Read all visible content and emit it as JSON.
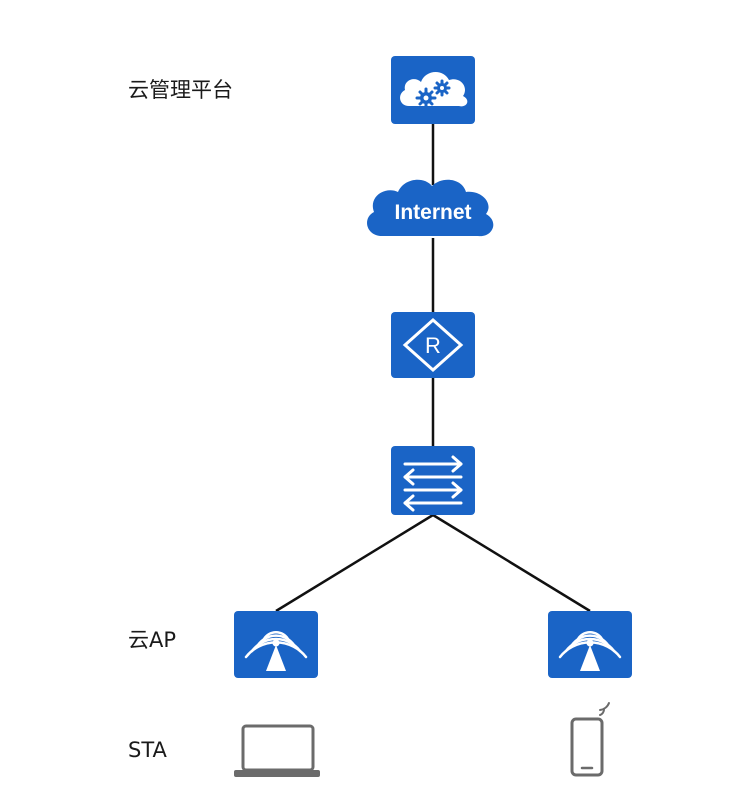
{
  "labels": {
    "cloud_platform": "云管理平台",
    "cloud_ap": "云AP",
    "sta": "STA"
  },
  "internet_label": "Internet",
  "router_letter": "R",
  "colors": {
    "device_blue": "#1a64c6",
    "device_white": "#ffffff",
    "link": "#111111",
    "endpoint_gray": "#6b6b6b"
  },
  "nodes": [
    {
      "id": "cloud-platform",
      "icon": "cloud-gear-icon"
    },
    {
      "id": "internet",
      "icon": "internet-cloud-icon"
    },
    {
      "id": "router",
      "icon": "router-icon"
    },
    {
      "id": "switch",
      "icon": "switch-icon"
    },
    {
      "id": "ap-1",
      "icon": "wireless-ap-icon"
    },
    {
      "id": "ap-2",
      "icon": "wireless-ap-icon"
    },
    {
      "id": "laptop",
      "icon": "laptop-icon"
    },
    {
      "id": "phone",
      "icon": "smartphone-icon"
    }
  ],
  "links": [
    [
      "cloud-platform",
      "internet"
    ],
    [
      "internet",
      "router"
    ],
    [
      "router",
      "switch"
    ],
    [
      "switch",
      "ap-1"
    ],
    [
      "switch",
      "ap-2"
    ]
  ]
}
